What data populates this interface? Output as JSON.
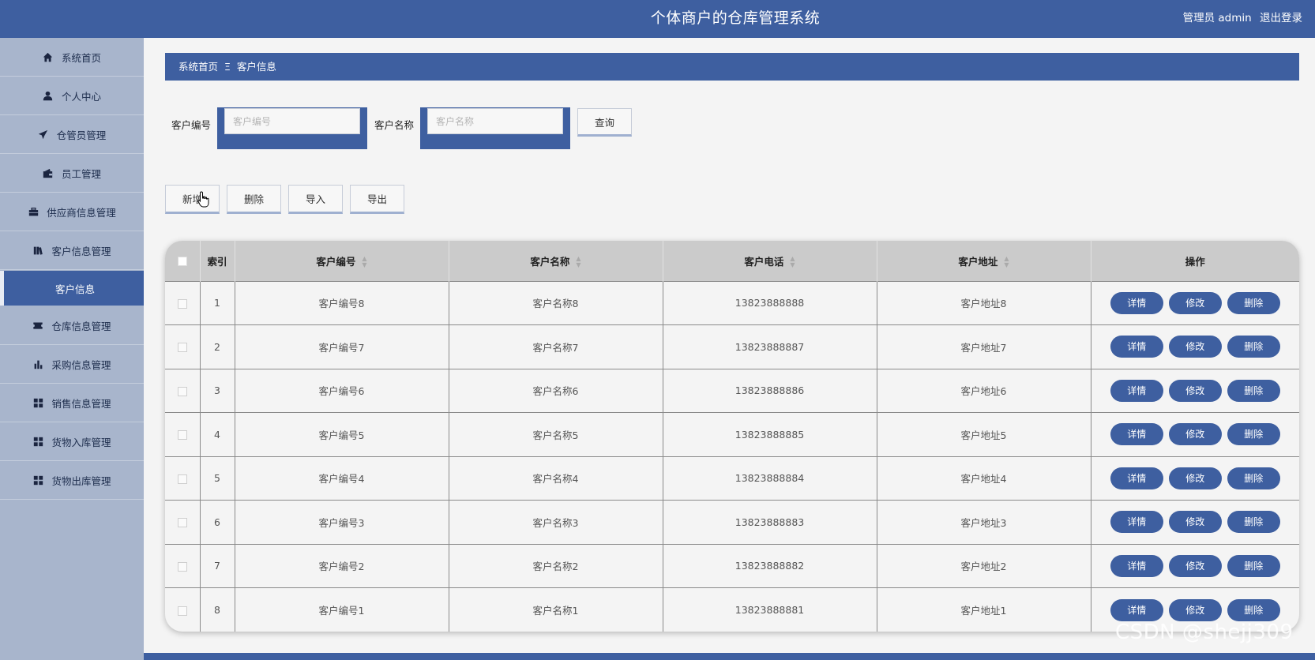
{
  "header": {
    "title": "个体商户的仓库管理系统",
    "user_role": "管理员 admin",
    "logout": "退出登录"
  },
  "sidebar": {
    "items": [
      {
        "label": "系统首页",
        "icon": "home-icon"
      },
      {
        "label": "个人中心",
        "icon": "user-icon"
      },
      {
        "label": "仓管员管理",
        "icon": "paper-plane-icon"
      },
      {
        "label": "员工管理",
        "icon": "wallet-icon"
      },
      {
        "label": "供应商信息管理",
        "icon": "briefcase-icon"
      },
      {
        "label": "客户信息管理",
        "icon": "books-icon"
      }
    ],
    "active_sub": "客户信息",
    "items_after": [
      {
        "label": "仓库信息管理",
        "icon": "ticket-icon"
      },
      {
        "label": "采购信息管理",
        "icon": "bar-chart-icon"
      },
      {
        "label": "销售信息管理",
        "icon": "grid-icon"
      },
      {
        "label": "货物入库管理",
        "icon": "grid-icon"
      },
      {
        "label": "货物出库管理",
        "icon": "grid-icon"
      }
    ]
  },
  "breadcrumb": {
    "home": "系统首页",
    "separator": "Ξ",
    "current": "客户信息"
  },
  "search": {
    "code_label": "客户编号",
    "code_placeholder": "客户编号",
    "name_label": "客户名称",
    "name_placeholder": "客户名称",
    "query_button": "查询"
  },
  "actions": {
    "add": "新增",
    "delete": "删除",
    "import": "导入",
    "export": "导出"
  },
  "table": {
    "headers": {
      "index": "索引",
      "code": "客户编号",
      "name": "客户名称",
      "phone": "客户电话",
      "address": "客户地址",
      "ops": "操作"
    },
    "rows": [
      {
        "index": "1",
        "code": "客户编号8",
        "name": "客户名称8",
        "phone": "13823888888",
        "address": "客户地址8"
      },
      {
        "index": "2",
        "code": "客户编号7",
        "name": "客户名称7",
        "phone": "13823888887",
        "address": "客户地址7"
      },
      {
        "index": "3",
        "code": "客户编号6",
        "name": "客户名称6",
        "phone": "13823888886",
        "address": "客户地址6"
      },
      {
        "index": "4",
        "code": "客户编号5",
        "name": "客户名称5",
        "phone": "13823888885",
        "address": "客户地址5"
      },
      {
        "index": "5",
        "code": "客户编号4",
        "name": "客户名称4",
        "phone": "13823888884",
        "address": "客户地址4"
      },
      {
        "index": "6",
        "code": "客户编号3",
        "name": "客户名称3",
        "phone": "13823888883",
        "address": "客户地址3"
      },
      {
        "index": "7",
        "code": "客户编号2",
        "name": "客户名称2",
        "phone": "13823888882",
        "address": "客户地址2"
      },
      {
        "index": "8",
        "code": "客户编号1",
        "name": "客户名称1",
        "phone": "13823888881",
        "address": "客户地址1"
      }
    ],
    "row_buttons": {
      "detail": "详情",
      "edit": "修改",
      "delete": "删除"
    }
  },
  "watermark": "CSDN @shejj309",
  "colors": {
    "primary": "#3e5fa0",
    "sidebar_bg": "#a8b5cc",
    "page_bg": "#f4f4f4",
    "table_header_bg": "#cbcbcb"
  }
}
